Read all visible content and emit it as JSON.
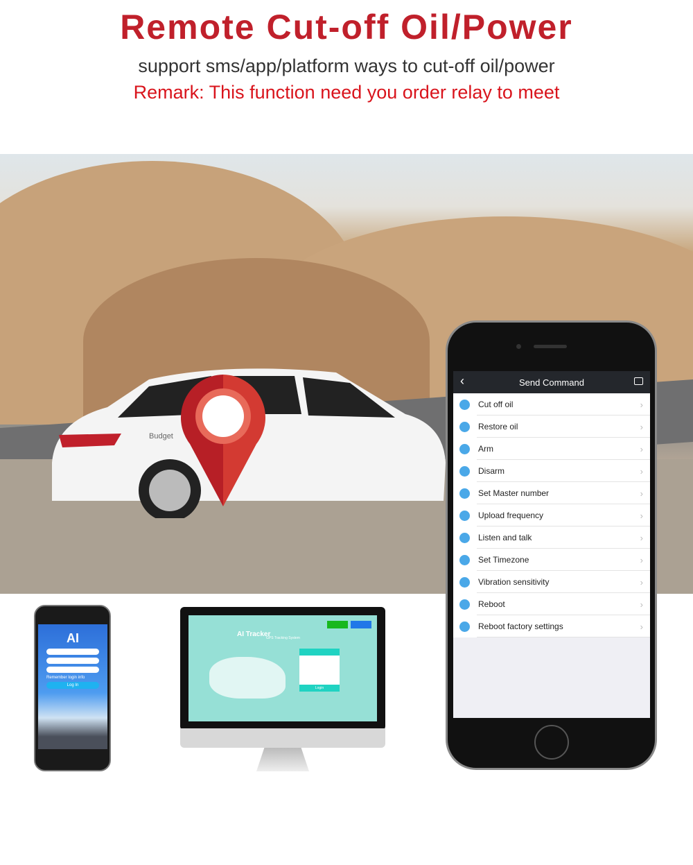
{
  "header": {
    "title": "Remote Cut-off Oil/Power",
    "subtitle": "support sms/app/platform ways to cut-off oil/power",
    "remark": "Remark: This function need you order relay to meet"
  },
  "car_brand": "Budget",
  "app": {
    "title": "Send Command",
    "back_icon": "chevron-left-icon",
    "message_icon": "message-icon",
    "commands": [
      {
        "label": "Cut off oil",
        "icon": "oil-icon"
      },
      {
        "label": "Restore oil",
        "icon": "oil-icon"
      },
      {
        "label": "Arm",
        "icon": "lock-icon"
      },
      {
        "label": "Disarm",
        "icon": "flag-icon"
      },
      {
        "label": "Set Master number",
        "icon": "phone-icon"
      },
      {
        "label": "Upload frequency",
        "icon": "upload-icon"
      },
      {
        "label": "Listen and talk",
        "icon": "phone-icon"
      },
      {
        "label": "Set Timezone",
        "icon": "moon-icon"
      },
      {
        "label": "Vibration sensitivity",
        "icon": "vibration-icon"
      },
      {
        "label": "Reboot",
        "icon": "monitor-icon"
      },
      {
        "label": "Reboot factory settings",
        "icon": "settings-icon"
      }
    ]
  },
  "mobile_login": {
    "logo": "AI",
    "remember": "Remember login info",
    "login": "Log In"
  },
  "platform": {
    "brand": "AI Tracker",
    "tagline": "GPS Tracking System",
    "login": "Login"
  },
  "colors": {
    "title": "#c0202b",
    "remark": "#d9141c",
    "accent": "#4aa8e8",
    "platform_bg": "#96e0d6"
  }
}
